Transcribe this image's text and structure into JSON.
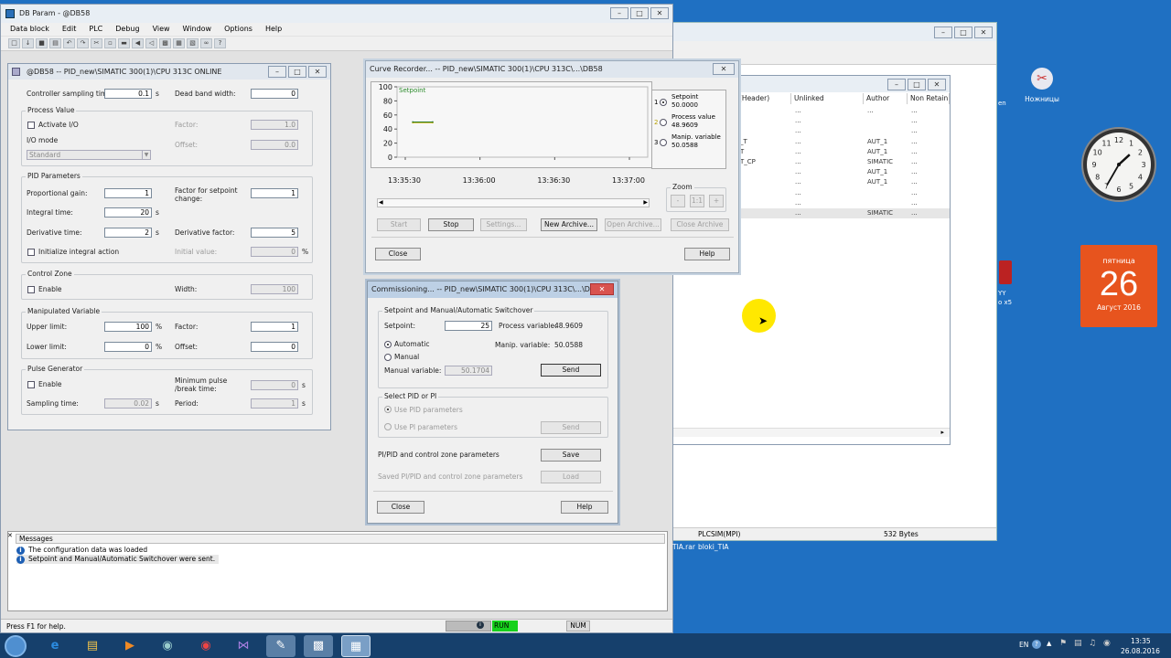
{
  "main": {
    "title": "DB Param - @DB58",
    "menu": [
      "Data block",
      "Edit",
      "PLC",
      "Debug",
      "View",
      "Window",
      "Options",
      "Help"
    ],
    "status_left": "Press F1 for help.",
    "status_run": "RUN",
    "status_num": "NUM"
  },
  "db": {
    "title": "@DB58 -- PID_new\\SIMATIC 300(1)\\CPU 313C  ONLINE",
    "controller_sampling_time_label": "Controller sampling time:",
    "controller_sampling_time": "0.1",
    "unit_s": "s",
    "unit_pct": "%",
    "dead_band_width_label": "Dead band width:",
    "dead_band_width": "0",
    "process_value_group": "Process Value",
    "activate_io_label": "Activate I/O",
    "io_mode_label": "I/O mode",
    "io_mode_value": "Standard",
    "pv_factor_label": "Factor:",
    "pv_factor": "1.0",
    "pv_offset_label": "Offset:",
    "pv_offset": "0.0",
    "pid_group": "PID Parameters",
    "proportional_gain_label": "Proportional gain:",
    "proportional_gain": "1",
    "factor_setpoint_label": "Factor for setpoint change:",
    "factor_setpoint": "1",
    "integral_time_label": "Integral time:",
    "integral_time": "20",
    "derivative_time_label": "Derivative time:",
    "derivative_time": "2",
    "derivative_factor_label": "Derivative factor:",
    "derivative_factor": "5",
    "initialize_integral_label": "Initialize integral action",
    "initial_value_label": "Initial value:",
    "initial_value": "0",
    "control_zone_group": "Control Zone",
    "cz_enable_label": "Enable",
    "cz_width_label": "Width:",
    "cz_width": "100",
    "manip_group": "Manipulated Variable",
    "upper_limit_label": "Upper limit:",
    "upper_limit": "100",
    "mv_factor_label": "Factor:",
    "mv_factor": "1",
    "lower_limit_label": "Lower limit:",
    "lower_limit": "0",
    "mv_offset_label": "Offset:",
    "mv_offset": "0",
    "pulse_group": "Pulse Generator",
    "pg_enable_label": "Enable",
    "min_pulse_label": "Minimum pulse /break time:",
    "min_pulse": "0",
    "sampling_time_label": "Sampling time:",
    "sampling_time": "0.02",
    "period_label": "Period:",
    "period": "1"
  },
  "curve": {
    "title": "Curve Recorder... -- PID_new\\SIMATIC 300(1)\\CPU 313C\\...\\DB58",
    "plot_label": "Setpoint",
    "legend": [
      {
        "num": "1",
        "name": "Setpoint",
        "value": "50.0000"
      },
      {
        "num": "2",
        "name": "Process value",
        "value": "48.9609"
      },
      {
        "num": "3",
        "name": "Manip. variable",
        "value": "50.0588"
      }
    ],
    "zoom_label": "Zoom",
    "zoom_minus": "-",
    "zoom_reset": "1:1",
    "zoom_plus": "+",
    "buttons": [
      "Start",
      "Stop",
      "Settings...",
      "New Archive...",
      "Open Archive...",
      "Close Archive"
    ],
    "close": "Close",
    "help": "Help"
  },
  "chart_data": {
    "type": "line",
    "ylim": [
      0,
      100
    ],
    "yticks": [
      "100",
      "80",
      "60",
      "40",
      "20",
      "0"
    ],
    "xticks": [
      "13:35:30",
      "13:36:00",
      "13:36:30",
      "13:37:00"
    ],
    "series": [
      {
        "name": "Setpoint",
        "color": "#333333",
        "x": [
          "13:35:33",
          "13:35:41"
        ],
        "values": [
          50,
          50
        ]
      },
      {
        "name": "Process value",
        "color": "#c8b400",
        "x": [
          "13:35:33",
          "13:35:41"
        ],
        "values": [
          48.96,
          48.96
        ]
      },
      {
        "name": "Manip. variable",
        "color": "#2a7a2a",
        "x": [
          "13:35:33",
          "13:35:41"
        ],
        "values": [
          50.06,
          50.06
        ]
      }
    ]
  },
  "commissioning": {
    "title": "Commissioning... -- PID_new\\SIMATIC 300(1)\\CPU 313C\\...\\DB58",
    "setpoint_group": "Setpoint and Manual/Automatic Switchover",
    "setpoint_label": "Setpoint:",
    "setpoint": "25",
    "process_variable_label": "Process variable:",
    "process_variable": "48.9609",
    "manip_variable_label": "Manip. variable:",
    "manip_variable": "50.0588",
    "automatic_label": "Automatic",
    "manual_label": "Manual",
    "manual_variable_label": "Manual variable:",
    "manual_variable": "50.1704",
    "send": "Send",
    "select_group": "Select PID or PI",
    "use_pid": "Use PID parameters",
    "use_pi": "Use PI parameters",
    "send2": "Send",
    "pipid_label": "PI/PID and control zone parameters",
    "save": "Save",
    "saved_label": "Saved PI/PID and control zone parameters",
    "load": "Load",
    "close": "Close",
    "help": "Help"
  },
  "bg_window": {
    "headers": [
      "(Header)",
      "Unlinked",
      "Author",
      "Non Retain"
    ],
    "rows": [
      [
        "",
        "...",
        "...",
        "..."
      ],
      [
        "",
        "...",
        "",
        "..."
      ],
      [
        "",
        "...",
        "",
        "..."
      ],
      [
        "_T",
        "...",
        "AUT_1",
        "..."
      ],
      [
        "T",
        "...",
        "AUT_1",
        "..."
      ],
      [
        "T_CP",
        "...",
        "SIMATIC",
        "..."
      ],
      [
        "",
        "...",
        "AUT_1",
        "..."
      ],
      [
        "",
        "...",
        "AUT_1",
        "..."
      ],
      [
        "",
        "...",
        "",
        "..."
      ],
      [
        "",
        "...",
        "",
        "..."
      ],
      [
        "",
        "...",
        "SIMATIC",
        "..."
      ]
    ],
    "status_plc": "PLCSIM(MPI)",
    "status_size": "532 Bytes",
    "file1": "TIA.rar",
    "file2": "bloki_TIA"
  },
  "messages": {
    "title": "Messages",
    "items": [
      "The configuration data was loaded",
      "Setpoint and Manual/Automatic Switchover were sent."
    ]
  },
  "desktop": {
    "scissors_label": "Ножницы",
    "partial1": "en",
    "partial2": "YY",
    "partial3": "o x5",
    "calendar_day": "пятница",
    "calendar_date": "26",
    "calendar_month": "Август 2016",
    "clock_numbers": [
      "12",
      "1",
      "2",
      "3",
      "4",
      "5",
      "6",
      "7",
      "8",
      "9",
      "10",
      "11"
    ]
  },
  "taskbar": {
    "lang": "EN",
    "time": "13:35",
    "date": "26.08.2016"
  }
}
